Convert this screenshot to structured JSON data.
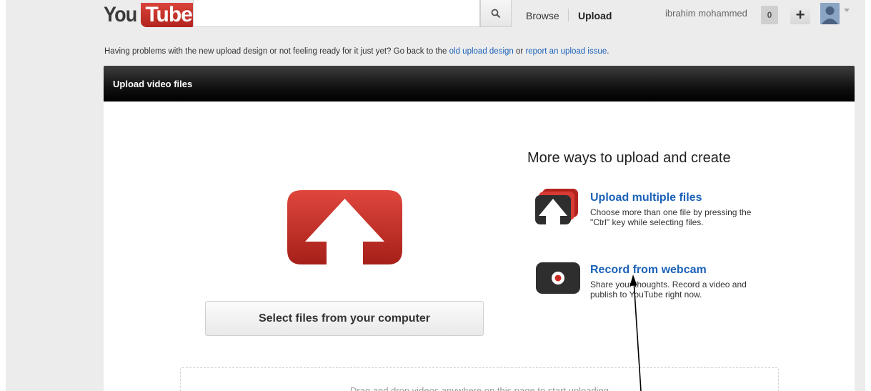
{
  "header": {
    "logo": {
      "you": "You",
      "tube": "Tube"
    },
    "search": {
      "value": "",
      "placeholder": ""
    },
    "nav": {
      "browse": "Browse",
      "upload": "Upload"
    },
    "user": {
      "name": "ibrahim mohammed",
      "notification_count": "0",
      "plus": "+"
    }
  },
  "notice": {
    "prefix": "Having problems with the new upload design or not feeling ready for it just yet? Go back to the ",
    "link1": "old upload design",
    "middle": " or ",
    "link2": "report an upload issue",
    "suffix": "."
  },
  "panel": {
    "title": "Upload video files",
    "select_button": "Select files from your computer",
    "more_title": "More ways to upload and create",
    "options": [
      {
        "title": "Upload multiple files",
        "desc": "Choose more than one file by pressing the \"Ctrl\" key while selecting files.",
        "icon": "upload-multiple-icon"
      },
      {
        "title": "Record from webcam",
        "desc": "Share your thoughts. Record a video and publish to YouTube right now.",
        "icon": "webcam-icon"
      }
    ],
    "drop_text": "Drag and drop videos anywhere on this page to start uploading"
  },
  "colors": {
    "accent": "#c4302b",
    "link": "#1c62b9",
    "header_bar": "#111111"
  }
}
